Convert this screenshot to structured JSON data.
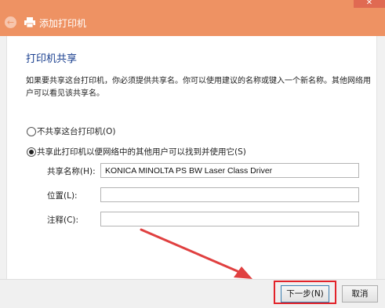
{
  "window": {
    "close_glyph": "✕"
  },
  "nav": {
    "back_glyph": "←",
    "title": "添加打印机"
  },
  "content": {
    "heading": "打印机共享",
    "description": "如果要共享这台打印机，你必须提供共享名。你可以使用建议的名称或键入一个新名称。其他网络用户可以看见该共享名。",
    "radio_options": [
      {
        "label": "不共享这台打印机(O)",
        "checked": false
      },
      {
        "label": "共享此打印机以便网络中的其他用户可以找到并使用它(S)",
        "checked": true
      }
    ],
    "fields": {
      "share_name": {
        "label": "共享名称(H):",
        "value": "KONICA MINOLTA PS BW Laser Class Driver"
      },
      "location": {
        "label": "位置(L):",
        "value": ""
      },
      "comment": {
        "label": "注释(C):",
        "value": ""
      }
    }
  },
  "footer": {
    "next_label": "下一步(N)",
    "cancel_label": "取消"
  },
  "colors": {
    "titlebar": "#ee9263",
    "heading": "#1a3f8f",
    "highlight": "#e2232a",
    "arrow": "#e04040"
  }
}
